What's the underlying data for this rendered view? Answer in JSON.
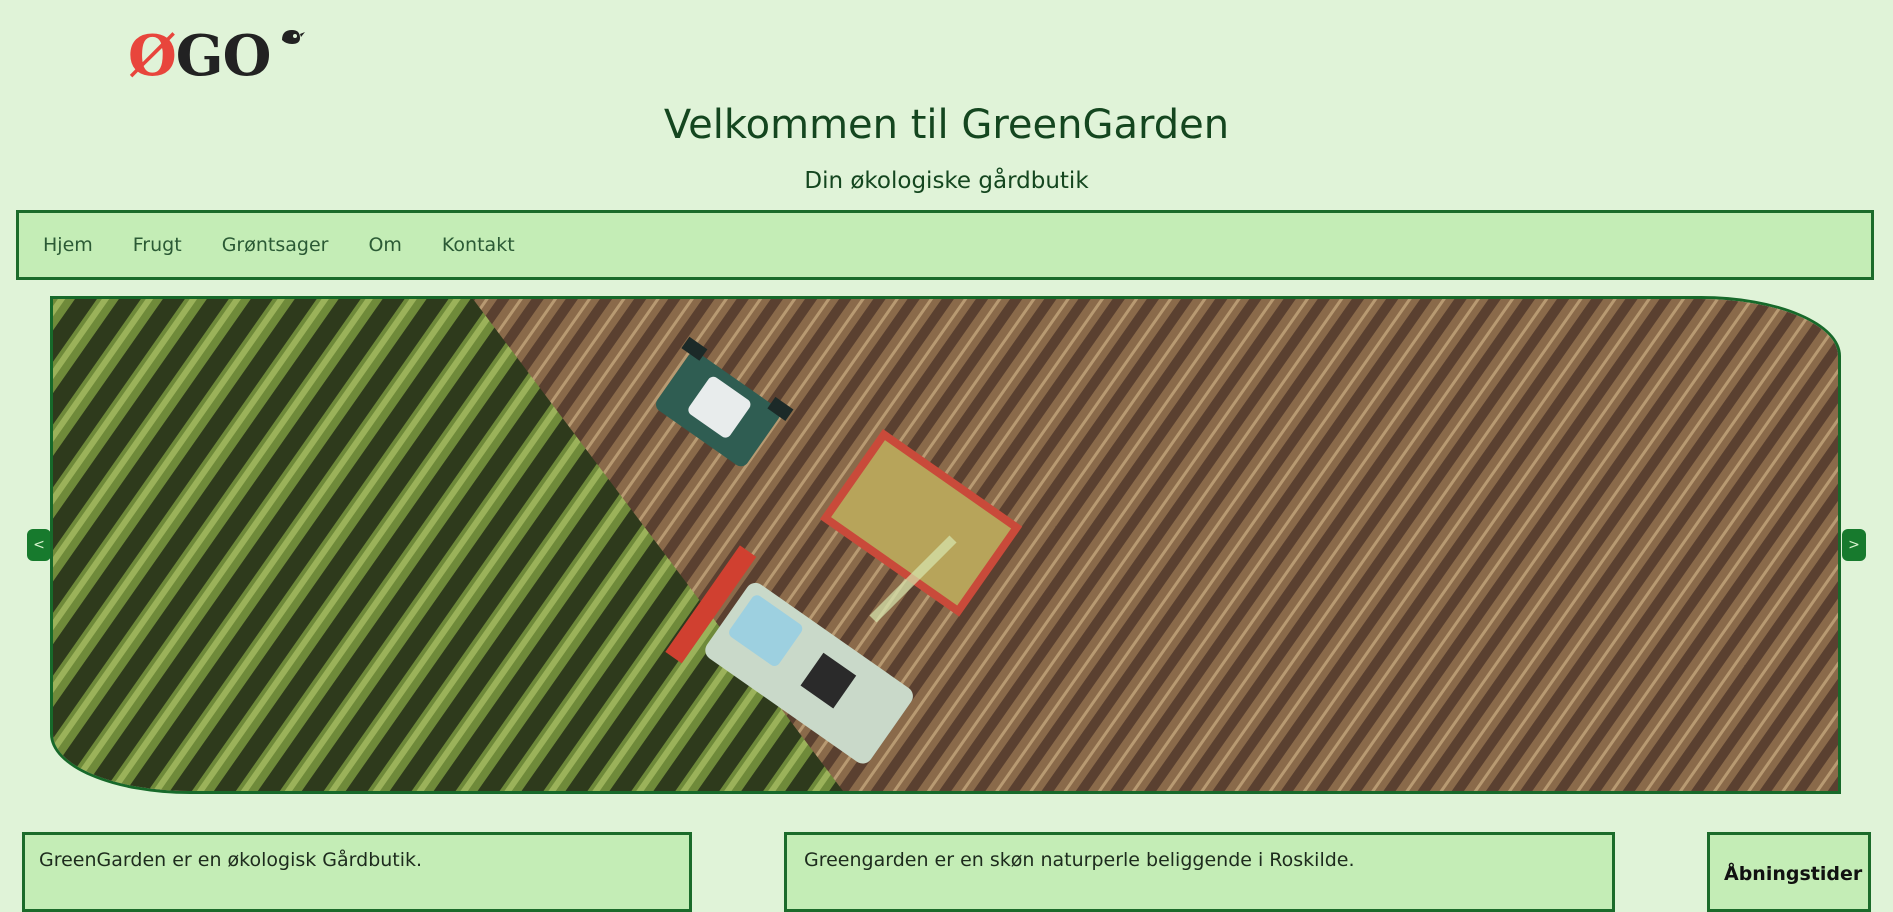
{
  "logo": {
    "text_a": "Ø",
    "text_b": "GO",
    "icon": "bird-icon"
  },
  "header": {
    "title": "Velkommen til GreenGarden",
    "subtitle": "Din økologiske gårdbutik"
  },
  "nav": {
    "items": [
      {
        "label": "Hjem"
      },
      {
        "label": "Frugt"
      },
      {
        "label": "Grøntsager"
      },
      {
        "label": "Om"
      },
      {
        "label": "Kontakt"
      }
    ]
  },
  "slider": {
    "prev_label": "<",
    "next_label": ">",
    "image": "aerial-field-harvest-image"
  },
  "boxes": {
    "intro": "GreenGarden er en økologisk Gårdbutik.",
    "location": "Greengarden er en skøn naturperle beliggende i Roskilde.",
    "hours_title": "Åbningstider"
  },
  "colors": {
    "background": "#e0f3d8",
    "panel": "#c4edb6",
    "border": "#1b6b2a",
    "logo_red": "#e8453c"
  }
}
